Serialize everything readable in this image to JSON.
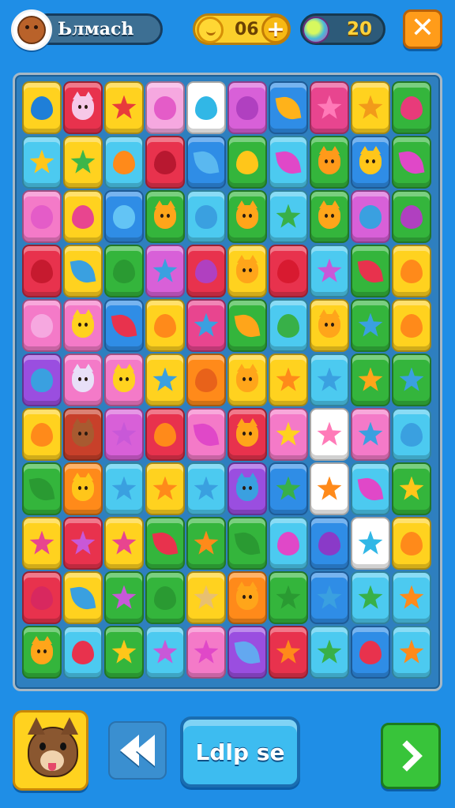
{
  "player": {
    "name": "Ьлмаch",
    "avatar_icon": "child-face-icon"
  },
  "currency": {
    "coins": "06",
    "coin_icon": "coin-icon",
    "add_icon": "plus-icon",
    "gems": "20",
    "gem_icon": "gem-icon"
  },
  "close_icon": "close-icon",
  "board": {
    "rows": [
      [
        [
          "#ffd21f",
          "drop",
          "#1f7fd8"
        ],
        [
          "#e8324d",
          "cat",
          "#f6c8e8"
        ],
        [
          "#ffd21f",
          "star",
          "#e83b3b"
        ],
        [
          "#f6a8e0",
          "blob",
          "#e45cc8"
        ],
        [
          "#ffffff",
          "drop",
          "#31b7e6"
        ],
        [
          "#d860d8",
          "blob",
          "#b040c0"
        ],
        [
          "#2f8de6",
          "leaf",
          "#ffb21a"
        ],
        [
          "#e8458f",
          "star",
          "#ff7ab8"
        ],
        [
          "#ffd21f",
          "star",
          "#f29a1a"
        ],
        [
          "#34b53c",
          "drop",
          "#e83b7a"
        ]
      ],
      [
        [
          "#4ccaf0",
          "star",
          "#ffc61a"
        ],
        [
          "#ffd21f",
          "star",
          "#3cb64a"
        ],
        [
          "#4ccaf0",
          "drop",
          "#ff8a1a"
        ],
        [
          "#e8324d",
          "drop",
          "#b81830"
        ],
        [
          "#2f8de6",
          "leaf",
          "#5ab8f0"
        ],
        [
          "#34b53c",
          "drop",
          "#ffc61a"
        ],
        [
          "#4ccaf0",
          "leaf",
          "#e048c8"
        ],
        [
          "#34b53c",
          "cat",
          "#ff9a1a"
        ],
        [
          "#2f8de6",
          "cat",
          "#ffc61a"
        ],
        [
          "#34b53c",
          "leaf",
          "#e048c8"
        ]
      ],
      [
        [
          "#f47ac8",
          "blob",
          "#e45cc8"
        ],
        [
          "#ffd21f",
          "drop",
          "#e8458f"
        ],
        [
          "#2f8de6",
          "blob",
          "#63c4f5"
        ],
        [
          "#34b53c",
          "cat",
          "#ffa51a"
        ],
        [
          "#4ccaf0",
          "blob",
          "#3aa0e0"
        ],
        [
          "#34b53c",
          "cat",
          "#ffa51a"
        ],
        [
          "#4ccaf0",
          "star",
          "#38b048"
        ],
        [
          "#34b53c",
          "cat",
          "#ffa51a"
        ],
        [
          "#d860d8",
          "blob",
          "#3aa0e0"
        ],
        [
          "#34b53c",
          "drop",
          "#b040c0"
        ]
      ],
      [
        [
          "#e8324d",
          "drop",
          "#c61a2f"
        ],
        [
          "#ffd21f",
          "leaf",
          "#3aa0e0"
        ],
        [
          "#34b53c",
          "drop",
          "#2a9a32"
        ],
        [
          "#d860d8",
          "star",
          "#3aa0e0"
        ],
        [
          "#e8324d",
          "drop",
          "#b040c0"
        ],
        [
          "#ffd21f",
          "cat",
          "#ffa51a"
        ],
        [
          "#e8324d",
          "drop",
          "#d81a30"
        ],
        [
          "#4ccaf0",
          "star",
          "#c858d8"
        ],
        [
          "#34b53c",
          "leaf",
          "#e8324d"
        ],
        [
          "#ffd21f",
          "drop",
          "#ff8a1a"
        ]
      ],
      [
        [
          "#f47ac8",
          "blob",
          "#f6a8e0"
        ],
        [
          "#f47ac8",
          "cat",
          "#ffd21f"
        ],
        [
          "#2f8de6",
          "leaf",
          "#e8324d"
        ],
        [
          "#ffd21f",
          "drop",
          "#ff8a1a"
        ],
        [
          "#e8458f",
          "star",
          "#3aa0e0"
        ],
        [
          "#34b53c",
          "leaf",
          "#ffa51a"
        ],
        [
          "#4ccaf0",
          "drop",
          "#38b048"
        ],
        [
          "#ffd21f",
          "cat",
          "#ffa51a"
        ],
        [
          "#34b53c",
          "star",
          "#3aa0e0"
        ],
        [
          "#ffd21f",
          "drop",
          "#ff8a1a"
        ]
      ],
      [
        [
          "#9a4ee0",
          "blob",
          "#3aa0e0"
        ],
        [
          "#f47ac8",
          "cat",
          "#e8e0f8"
        ],
        [
          "#f47ac8",
          "cat",
          "#ffd21f"
        ],
        [
          "#ffd21f",
          "star",
          "#3aa0e0"
        ],
        [
          "#ff8a1a",
          "drop",
          "#e8621a"
        ],
        [
          "#ffd21f",
          "cat",
          "#ffa51a"
        ],
        [
          "#ffd21f",
          "star",
          "#ff8a1a"
        ],
        [
          "#4ccaf0",
          "star",
          "#3aa0e0"
        ],
        [
          "#34b53c",
          "star",
          "#ffa51a"
        ],
        [
          "#34b53c",
          "star",
          "#3aa0e0"
        ]
      ],
      [
        [
          "#ffd21f",
          "drop",
          "#ff8a1a"
        ],
        [
          "#c8402a",
          "cat",
          "#a85a30"
        ],
        [
          "#d860d8",
          "star",
          "#c858d8"
        ],
        [
          "#e8324d",
          "drop",
          "#ff8a1a"
        ],
        [
          "#f47ac8",
          "leaf",
          "#e048c8"
        ],
        [
          "#e8324d",
          "cat",
          "#ffa51a"
        ],
        [
          "#f47ac8",
          "star",
          "#ffd21f"
        ],
        [
          "#ffffff",
          "star",
          "#ff7ab8"
        ],
        [
          "#f47ac8",
          "star",
          "#3aa0e0"
        ],
        [
          "#4ccaf0",
          "drop",
          "#3aa0e0"
        ]
      ],
      [
        [
          "#34b53c",
          "leaf",
          "#2a9a32"
        ],
        [
          "#ff8a1a",
          "cat",
          "#ffc61a"
        ],
        [
          "#4ccaf0",
          "star",
          "#3aa0e0"
        ],
        [
          "#ffd21f",
          "star",
          "#ff8a1a"
        ],
        [
          "#4ccaf0",
          "star",
          "#3aa0e0"
        ],
        [
          "#9a4ee0",
          "cat",
          "#3aa0e0"
        ],
        [
          "#2f8de6",
          "star",
          "#38b048"
        ],
        [
          "#ffffff",
          "star",
          "#ff8a1a"
        ],
        [
          "#4ccaf0",
          "leaf",
          "#e048c8"
        ],
        [
          "#34b53c",
          "star",
          "#ffc61a"
        ]
      ],
      [
        [
          "#ffd21f",
          "star",
          "#e8458f"
        ],
        [
          "#e8324d",
          "star",
          "#c858d8"
        ],
        [
          "#ffd21f",
          "star",
          "#e8458f"
        ],
        [
          "#34b53c",
          "leaf",
          "#e8324d"
        ],
        [
          "#34b53c",
          "star",
          "#ff8a1a"
        ],
        [
          "#34b53c",
          "leaf",
          "#2a9a32"
        ],
        [
          "#4ccaf0",
          "drop",
          "#e048c8"
        ],
        [
          "#2f8de6",
          "drop",
          "#8a3ac8"
        ],
        [
          "#ffffff",
          "star",
          "#31b7e6"
        ],
        [
          "#ffd21f",
          "drop",
          "#ff8a1a"
        ]
      ],
      [
        [
          "#e8324d",
          "drop",
          "#d8285f"
        ],
        [
          "#ffd21f",
          "leaf",
          "#3aa0e0"
        ],
        [
          "#34b53c",
          "star",
          "#c858d8"
        ],
        [
          "#34b53c",
          "drop",
          "#2a9a32"
        ],
        [
          "#ffd21f",
          "star",
          "#e8c070"
        ],
        [
          "#ff8a1a",
          "cat",
          "#ffa51a"
        ],
        [
          "#34b53c",
          "star",
          "#2a9a32"
        ],
        [
          "#2f8de6",
          "star",
          "#3aa0e0"
        ],
        [
          "#4ccaf0",
          "star",
          "#38b048"
        ],
        [
          "#4ccaf0",
          "star",
          "#ff8a1a"
        ]
      ],
      [
        [
          "#34b53c",
          "cat",
          "#ffa51a"
        ],
        [
          "#4ccaf0",
          "drop",
          "#e8324d"
        ],
        [
          "#34b53c",
          "star",
          "#ffc61a"
        ],
        [
          "#4ccaf0",
          "star",
          "#c858d8"
        ],
        [
          "#f47ac8",
          "star",
          "#e048c8"
        ],
        [
          "#9a4ee0",
          "leaf",
          "#63a8f0"
        ],
        [
          "#e8324d",
          "star",
          "#ff8a1a"
        ],
        [
          "#4ccaf0",
          "star",
          "#38b048"
        ],
        [
          "#2f8de6",
          "drop",
          "#e8324d"
        ],
        [
          "#4ccaf0",
          "star",
          "#ff8a1a"
        ]
      ]
    ]
  },
  "pet_icon": "dog-face-icon",
  "rewind_icon": "rewind-icon",
  "main_button": "Ldlp se",
  "next_icon": "chevron-right-icon"
}
